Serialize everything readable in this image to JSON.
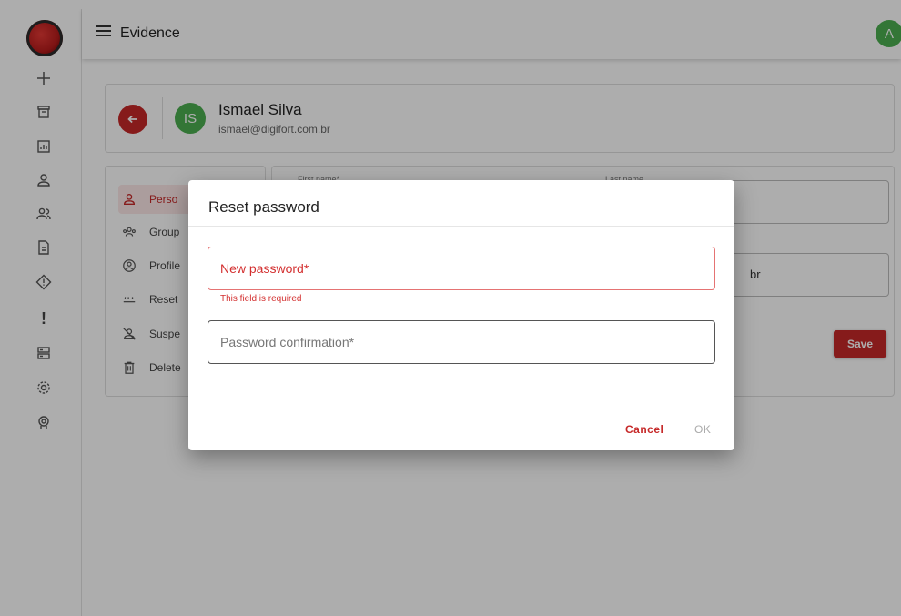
{
  "header": {
    "title": "Evidence",
    "avatar_initial": "A"
  },
  "user": {
    "initials": "IS",
    "name": "Ismael Silva",
    "email": "ismael@digifort.com.br"
  },
  "nav": {
    "items": [
      {
        "label": "Perso",
        "icon": "person-icon"
      },
      {
        "label": "Group",
        "icon": "groups-icon"
      },
      {
        "label": "Profile",
        "icon": "account-circle-icon"
      },
      {
        "label": "Reset",
        "icon": "password-icon"
      },
      {
        "label": "Suspe",
        "icon": "person-off-icon"
      },
      {
        "label": "Delete",
        "icon": "delete-icon"
      }
    ]
  },
  "form": {
    "first_name_label": "First name*",
    "last_name_label": "Last name",
    "email_partial": "br",
    "save_label": "Save"
  },
  "dialog": {
    "title": "Reset password",
    "new_password_placeholder": "New password*",
    "error_text": "This field is required",
    "confirm_placeholder": "Password confirmation*",
    "cancel_label": "Cancel",
    "ok_label": "OK"
  },
  "colors": {
    "accent": "#c62828",
    "avatar": "#4caf50",
    "error": "#d32f2f"
  }
}
